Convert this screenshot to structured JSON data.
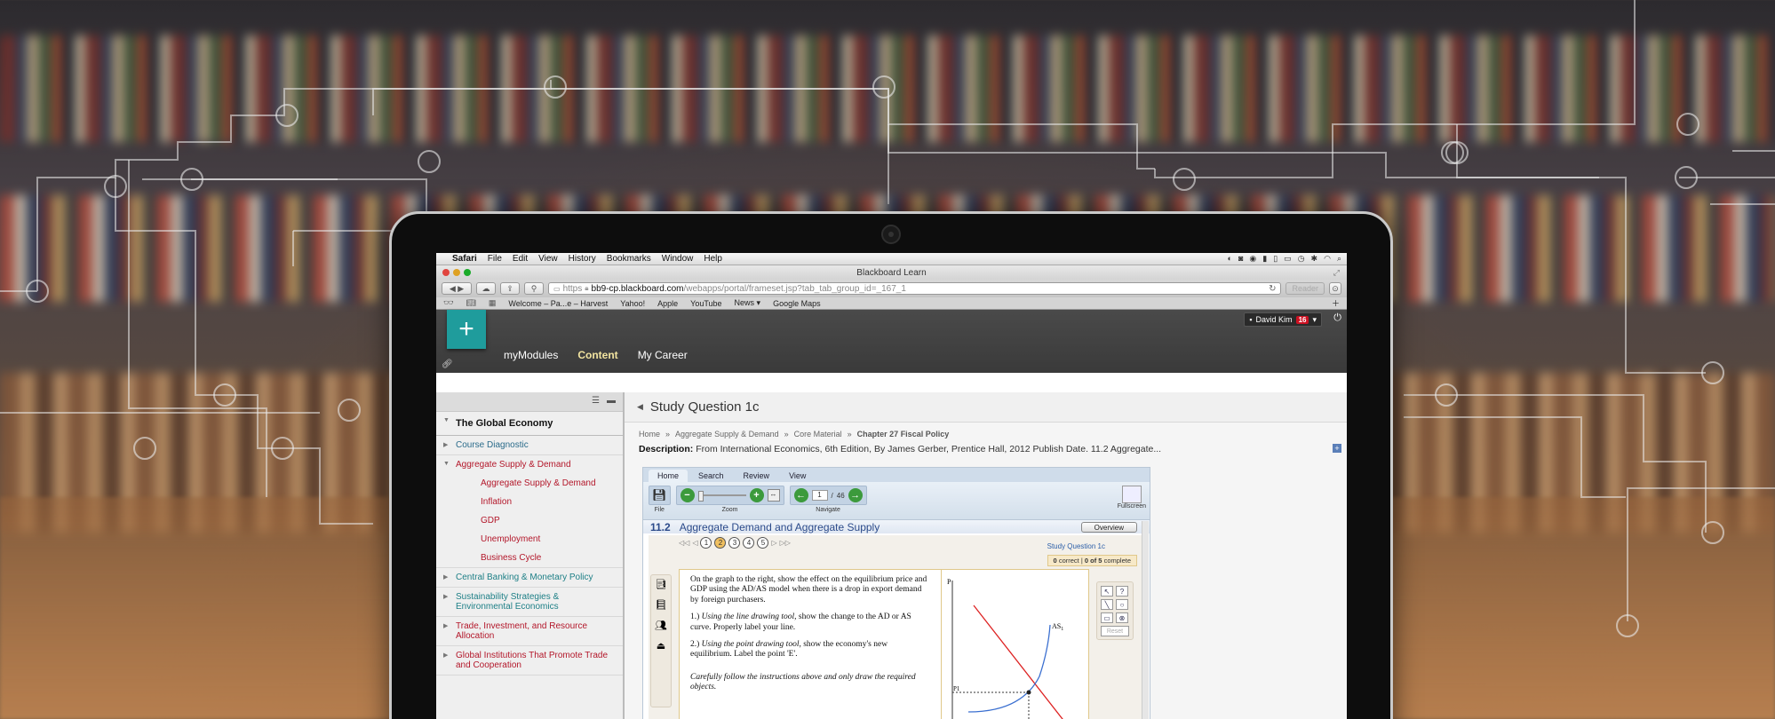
{
  "background": {
    "circuit_color": "rgba(235,235,235,0.55)"
  },
  "os_menubar": {
    "app": "Safari",
    "items": [
      "File",
      "Edit",
      "View",
      "History",
      "Bookmarks",
      "Window",
      "Help"
    ]
  },
  "browser": {
    "window_title": "Blackboard Learn",
    "url_scheme": "https",
    "url_host": "bb9-cp.blackboard.com",
    "url_path": "/webapps/portal/frameset.jsp?tab_tab_group_id=_167_1",
    "reader_label": "Reader",
    "bookmarks": [
      "Welcome – Pa...e – Harvest",
      "Yahoo!",
      "Apple",
      "YouTube",
      "News ▾",
      "Google Maps"
    ]
  },
  "lms_header": {
    "nav": [
      "myModules",
      "Content",
      "My Career"
    ],
    "active_nav": "Content",
    "user_name": "David Kim",
    "notification_count": "16",
    "brand_color": "#1f9c9c"
  },
  "sidebar": {
    "title": "The Global Economy",
    "items": [
      {
        "label": "Course Diagnostic"
      },
      {
        "label": "Aggregate Supply & Demand"
      },
      {
        "label": "Central Banking & Monetary Policy"
      },
      {
        "label": "Sustainability Strategies & Environmental Economics"
      },
      {
        "label": "Trade, Investment, and Resource Allocation"
      },
      {
        "label": "Global Institutions That Promote Trade and Cooperation"
      }
    ],
    "subitems": [
      "Aggregate Supply & Demand",
      "Inflation",
      "GDP",
      "Unemployment",
      "Business Cycle"
    ]
  },
  "content": {
    "page_title": "Study Question 1c",
    "breadcrumbs": [
      "Home",
      "Aggregate Supply & Demand",
      "Core Material",
      "Chapter 27 Fiscal Policy"
    ],
    "description_label": "Description:",
    "description_text": "From International Economics, 6th Edition, By James Gerber, Prentice Hall, 2012 Publish Date. 11.2 Aggregate..."
  },
  "viewer": {
    "tabs": [
      "Home",
      "Search",
      "Review",
      "View"
    ],
    "groups": {
      "file": "File",
      "zoom": "Zoom",
      "navigate": "Navigate",
      "fullscreen": "Fullscreen"
    },
    "page_current": "1",
    "page_sep": "/",
    "page_total": "46",
    "section_number": "11.2",
    "section_title": "Aggregate Demand and Aggregate Supply",
    "overview_label": "Overview",
    "question_pages": [
      "1",
      "2",
      "3",
      "4",
      "5"
    ],
    "current_question_page": "2",
    "question_label": "Study Question 1c",
    "correct": "0",
    "correct_label": "correct",
    "sep": "|",
    "complete": "0 of 5",
    "complete_label": "complete",
    "question_para1": "On the graph to the right, show the effect on the equilibrium price and GDP using the AD/AS model when there is a drop in export demand by foreign purchasers.",
    "q1_prefix": "1.) ",
    "q1_em": "Using the line drawing tool",
    "q1_rest": ", show the change to the AD or AS curve.  Properly label your line.",
    "q2_prefix": "2.) ",
    "q2_em": "Using the point drawing tool",
    "q2_rest": ", show the economy's new equilibrium.  Label the point 'E'.",
    "instruction": "Carefully follow the instructions above and only draw the required objects.",
    "graph_p_label": "P",
    "graph_p1_label": "P1",
    "graph_as_label": "AS",
    "graph_as_sub": "1",
    "reset_label": "Reset"
  }
}
